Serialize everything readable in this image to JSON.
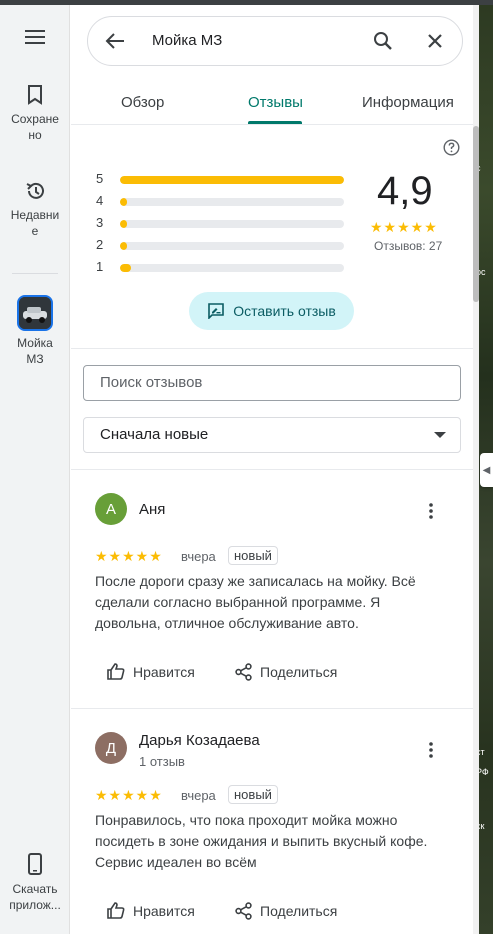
{
  "search": {
    "query": "Мойка МЗ"
  },
  "tabs": [
    {
      "label": "Обзор"
    },
    {
      "label": "Отзывы"
    },
    {
      "label": "Информация"
    }
  ],
  "rail": {
    "saved": "Сохранено",
    "recent": "Недавние",
    "place": "Мойка МЗ",
    "download": "Скачать приложение"
  },
  "rail_display": {
    "saved": "Сохране\nно",
    "recent": "Недавни\nе",
    "place": "Мойка\nМЗ",
    "download": "Скачать\nприлож..."
  },
  "summary": {
    "rating": "4,9",
    "stars": "★★★★★",
    "count_text": "Отзывов: 27",
    "distribution": [
      {
        "stars": "5",
        "fraction": 1.0
      },
      {
        "stars": "4",
        "fraction": 0.01
      },
      {
        "stars": "3",
        "fraction": 0.01
      },
      {
        "stars": "2",
        "fraction": 0.01
      },
      {
        "stars": "1",
        "fraction": 0.05
      }
    ]
  },
  "write_review_label": "Оставить отзыв",
  "search_reviews_placeholder": "Поиск отзывов",
  "sort_label": "Сначала новые",
  "reviews": [
    {
      "initial": "А",
      "author": "Аня",
      "sub": "",
      "avatar_color": "#689f38",
      "stars": "★★★★★",
      "when": "вчера",
      "badge": "новый",
      "text": "После дороги сразу же записалась на мойку. Всё сделали согласно выбранной программе. Я довольна, отличное обслуживание авто.",
      "like": "Нравится",
      "share": "Поделиться"
    },
    {
      "initial": "Д",
      "author": "Дарья Козадаева",
      "sub": "1 отзыв",
      "avatar_color": "#8d6e63",
      "stars": "★★★★★",
      "when": "вчера",
      "badge": "новый",
      "text": "Понравилось, что пока проходит мойка можно посидеть в зоне ожидания и выпить вкусный кофе. Сервис идеален во всём",
      "like": "Нравится",
      "share": "Поделиться"
    }
  ],
  "map_labels": [
    "с",
    "ос",
    "ст",
    "РФ",
    "ск"
  ],
  "colors": {
    "accent": "#00796b",
    "star": "#fbbc04",
    "write_btn_bg": "#d2f4f8"
  }
}
